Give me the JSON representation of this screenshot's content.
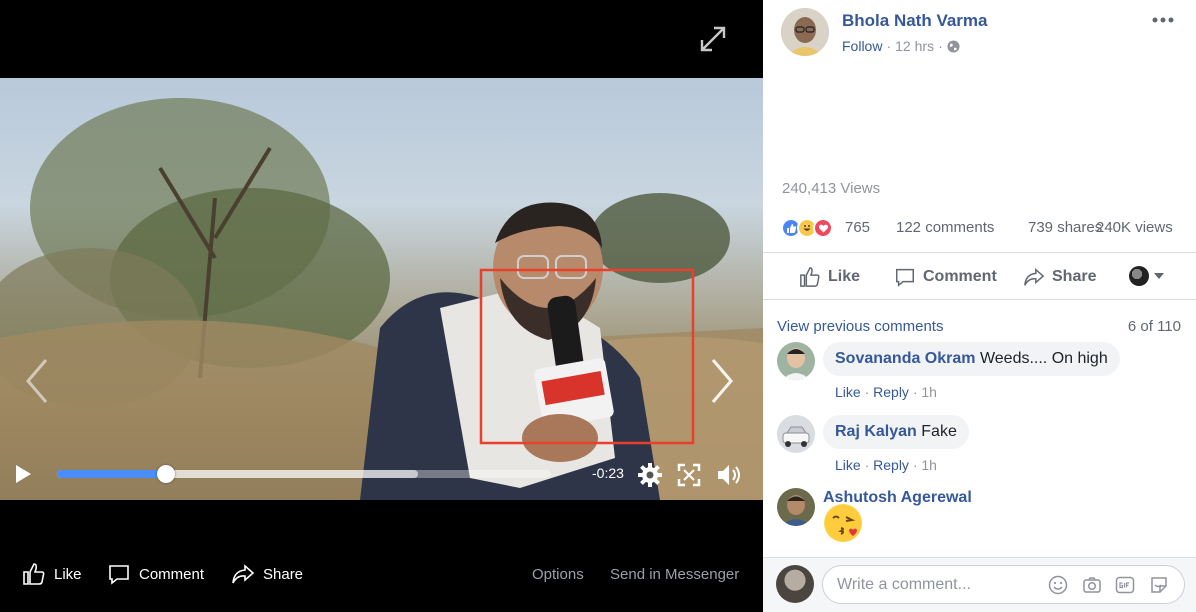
{
  "video": {
    "time_remaining": "-0:23",
    "progress_fraction": 0.22,
    "buffered_fraction": 0.73,
    "footer": {
      "like_label": "Like",
      "comment_label": "Comment",
      "share_label": "Share",
      "options_label": "Options",
      "send_label": "Send in Messenger"
    }
  },
  "post": {
    "author_name": "Bhola Nath Varma",
    "follow_label": "Follow",
    "time_label": "12 hrs",
    "views_label": "240,413 Views",
    "reaction_count": "765",
    "comments_count": "122 comments",
    "shares_count": "739 shares",
    "views_count": "240K views",
    "actions": {
      "like": "Like",
      "comment": "Comment",
      "share": "Share"
    }
  },
  "comments": {
    "view_previous_label": "View previous comments",
    "count_label": "6 of 110",
    "like_label": "Like",
    "reply_label": "Reply",
    "items": [
      {
        "author": "Sovananda Okram",
        "text": "Weeds.... On high",
        "time": "1h"
      },
      {
        "author": "Raj Kalyan",
        "text": "Fake",
        "time": "1h"
      },
      {
        "author": "Ashutosh Agerewal",
        "text": ""
      }
    ],
    "input_placeholder": "Write a comment..."
  },
  "colors": {
    "link_blue": "#365899",
    "progress_blue": "#4a8df8",
    "highlight_box": "#e8402a"
  }
}
